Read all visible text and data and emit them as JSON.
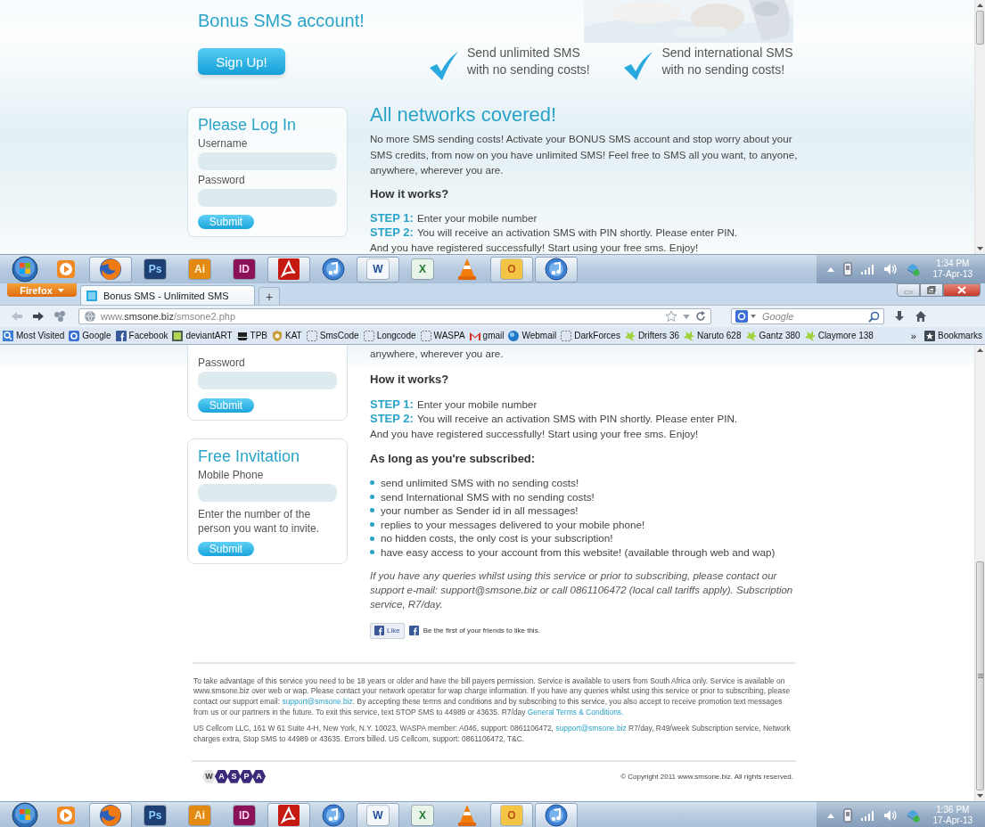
{
  "top_page": {
    "header": {
      "title": "Bonus SMS account!",
      "signup": "Sign Up!",
      "features": [
        "Send unlimited SMS\nwith no sending costs!",
        "Send international SMS\nwith no sending costs!"
      ]
    },
    "login": {
      "title": "Please Log In",
      "fields": [
        {
          "label": "Username"
        },
        {
          "label": "Password"
        }
      ],
      "submit": "Submit"
    },
    "main": {
      "heading": "All networks covered!",
      "paragraph": "No more SMS sending costs! Activate your BONUS SMS account and stop worry about your SMS credits, from now on you have unlimited SMS! Feel free to SMS all you want, to anyone, anywhere, wherever you are.",
      "subheading": "How it works?",
      "steps": [
        {
          "label": "STEP 1:",
          "text": "Enter your mobile number"
        },
        {
          "label": "STEP 2:",
          "text": "You will receive an activation SMS with PIN shortly. Please enter PIN."
        }
      ],
      "closing": "And you have registered successfully! Start using your free sms. Enjoy!"
    }
  },
  "taskbar_top": {
    "apps": [
      {
        "kind": "start",
        "open": false
      },
      {
        "kind": "media",
        "open": false
      },
      {
        "kind": "firefox",
        "open": true
      },
      {
        "kind": "ps",
        "label": "Ps",
        "open": false
      },
      {
        "kind": "ai",
        "label": "Ai",
        "open": false
      },
      {
        "kind": "id",
        "label": "ID",
        "open": false
      },
      {
        "kind": "acrobat",
        "open": true
      },
      {
        "kind": "itunes",
        "open": false
      },
      {
        "kind": "word",
        "label": "W",
        "open": true
      },
      {
        "kind": "excel",
        "label": "X",
        "open": false
      },
      {
        "kind": "vlc",
        "open": false
      },
      {
        "kind": "outlook",
        "label": "O",
        "open": true
      },
      {
        "kind": "itunes",
        "open": true
      }
    ],
    "time": "1:34 PM",
    "date": "17-Apr-13"
  },
  "browser": {
    "menu_button": "Firefox",
    "tabs": [
      {
        "title": "Bonus SMS - Unlimited SMS",
        "selected": true
      }
    ],
    "new_tab": "+",
    "back_disabled": true,
    "url": "www.**smsone.biz**/smsone2.php",
    "search_placeholder": "Google",
    "bookmarks": [
      {
        "kind": "most-visited",
        "label": "Most Visited"
      },
      {
        "kind": "google",
        "label": "Google"
      },
      {
        "kind": "facebook",
        "label": "Facebook"
      },
      {
        "kind": "deviantart",
        "label": "deviantART"
      },
      {
        "kind": "ship",
        "label": "TPB"
      },
      {
        "kind": "shield",
        "label": "KAT"
      },
      {
        "kind": "folder",
        "label": "SmsCode"
      },
      {
        "kind": "folder",
        "label": "Longcode"
      },
      {
        "kind": "folder",
        "label": "WASPA"
      },
      {
        "kind": "gmail",
        "label": "gmail"
      },
      {
        "kind": "globe",
        "label": "Webmail"
      },
      {
        "kind": "folder",
        "label": "DarkForces"
      },
      {
        "kind": "splat",
        "label": "Drifters 36"
      },
      {
        "kind": "splat",
        "label": "Naruto 628"
      },
      {
        "kind": "splat",
        "label": "Gantz 380"
      },
      {
        "kind": "splat",
        "label": "Claymore 138"
      }
    ],
    "overflow": "»",
    "bookmarks_menu": "Bookmarks"
  },
  "page": {
    "login": {
      "fields": [
        {
          "label": "Password"
        }
      ],
      "submit": "Submit"
    },
    "invitation": {
      "title": "Free Invitation",
      "field_label": "Mobile Phone",
      "hint": "Enter the number of the person you want to invite.",
      "submit": "Submit"
    },
    "main": {
      "paragraph_end": "anywhere, wherever you are.",
      "subheading": "How it works?",
      "steps": [
        {
          "label": "STEP 1:",
          "text": "Enter your mobile number"
        },
        {
          "label": "STEP 2:",
          "text": "You will receive an activation SMS with PIN shortly. Please enter PIN."
        }
      ],
      "closing": "And you have registered successfully! Start using your free sms. Enjoy!",
      "benefits_heading": "As long as you're subscribed:",
      "benefits": [
        "send unlimited SMS with no sending costs!",
        "send International SMS with no sending costs!",
        "your number as Sender id in all messages!",
        "replies to your messages delivered to your mobile phone!",
        "no hidden costs, the only cost is your subscription!",
        "have easy access to your account from this website! (available through web and wap)"
      ],
      "notice": "If you have any queries whilst using this service or prior to subscribing, please contact our support e-mail: support@smsone.biz or call 0861106472 (local call tariffs apply). Subscription service, R7/day.",
      "like": {
        "button": "Like",
        "text": "Be the first of your friends to like this."
      }
    },
    "footer": {
      "paragraphs": [
        [
          {
            "text": "To take advantage of this service you need to be 18 years or older and have the bill payers permission. Service is available to users from South Africa only. Service is available on www.smsone.biz over web or wap. Please contact your network operator for wap charge information. If you have any queries whilst using this service or prior to subscribing, please contact our support email: ",
            "link": false
          },
          {
            "text": "support@smsone.biz",
            "link": true
          },
          {
            "text": ". By accepting these terms and conditions and by subscribing to this service, you also accept to receive promotion text messages from us or our partners in the future. To exit this service, text STOP SMS to 44989 or 43635. R7/day ",
            "link": false
          },
          {
            "text": "General Terms & Conditions.",
            "link": true
          }
        ],
        [
          {
            "text": "US Cellcom LLC, 161 W 61 Suite 4-H, New York, N.Y. 10023, WASPA member: A046, support: 0861106472, ",
            "link": false
          },
          {
            "text": "support@smsone.biz",
            "link": true
          },
          {
            "text": " R7/day, R49/week Subscription service, Network charges extra, Stop SMS to 44989 or 43635. Errors billed. US Cellcom, support: 0861106472, T&C.",
            "link": false
          }
        ]
      ],
      "logo_letters": [
        "W",
        "A",
        "S",
        "P",
        "A"
      ],
      "copyright": "© Copyright 2011 www.smsone.biz. All rights reserved."
    }
  },
  "taskbar_bottom": {
    "apps": [
      {
        "kind": "start",
        "open": false
      },
      {
        "kind": "media",
        "open": false
      },
      {
        "kind": "firefox",
        "open": true
      },
      {
        "kind": "ps",
        "label": "Ps",
        "open": false
      },
      {
        "kind": "ai",
        "label": "Ai",
        "open": false
      },
      {
        "kind": "id",
        "label": "ID",
        "open": false
      },
      {
        "kind": "acrobat",
        "open": true
      },
      {
        "kind": "itunes",
        "open": false
      },
      {
        "kind": "word",
        "label": "W",
        "open": true
      },
      {
        "kind": "excel",
        "label": "X",
        "open": false
      },
      {
        "kind": "vlc",
        "open": false
      },
      {
        "kind": "outlook",
        "label": "O",
        "open": true
      },
      {
        "kind": "itunes",
        "open": true
      }
    ],
    "time": "1:36 PM",
    "date": "17-Apr-13"
  }
}
